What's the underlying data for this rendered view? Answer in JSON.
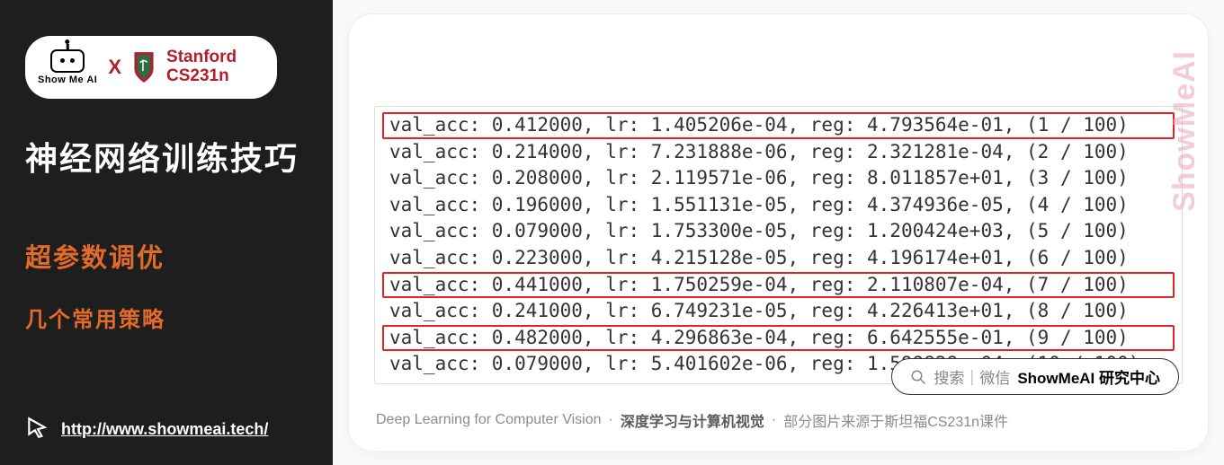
{
  "sidebar": {
    "logo": {
      "ai_label": "Show Me AI",
      "x": "X",
      "uni": "Stanford",
      "course": "CS231n"
    },
    "title": "神经网络训练技巧",
    "sub1": "超参数调优",
    "sub2": "几个常用策略",
    "url": "http://www.showmeai.tech/"
  },
  "watermark": "ShowMeAI",
  "console": {
    "lines": [
      {
        "hl": true,
        "text": "val_acc: 0.412000, lr: 1.405206e-04, reg: 4.793564e-01, (1 / 100)"
      },
      {
        "hl": false,
        "text": "val_acc: 0.214000, lr: 7.231888e-06, reg: 2.321281e-04, (2 / 100)"
      },
      {
        "hl": false,
        "text": "val_acc: 0.208000, lr: 2.119571e-06, reg: 8.011857e+01, (3 / 100)"
      },
      {
        "hl": false,
        "text": "val_acc: 0.196000, lr: 1.551131e-05, reg: 4.374936e-05, (4 / 100)"
      },
      {
        "hl": false,
        "text": "val_acc: 0.079000, lr: 1.753300e-05, reg: 1.200424e+03, (5 / 100)"
      },
      {
        "hl": false,
        "text": "val_acc: 0.223000, lr: 4.215128e-05, reg: 4.196174e+01, (6 / 100)"
      },
      {
        "hl": true,
        "text": "val_acc: 0.441000, lr: 1.750259e-04, reg: 2.110807e-04, (7 / 100)"
      },
      {
        "hl": false,
        "text": "val_acc: 0.241000, lr: 6.749231e-05, reg: 4.226413e+01, (8 / 100)"
      },
      {
        "hl": true,
        "text": "val_acc: 0.482000, lr: 4.296863e-04, reg: 6.642555e-01, (9 / 100)"
      },
      {
        "hl": false,
        "text": "val_acc: 0.079000, lr: 5.401602e-06, reg: 1.599828e+04, (10 / 100)"
      }
    ]
  },
  "search": {
    "prefix": "搜索｜微信",
    "strong": "ShowMeAI 研究中心"
  },
  "footer": {
    "en": "Deep Learning for Computer Vision",
    "cn": "深度学习与计算机视觉",
    "credit": "部分图片来源于斯坦福CS231n课件",
    "dot": "·"
  }
}
